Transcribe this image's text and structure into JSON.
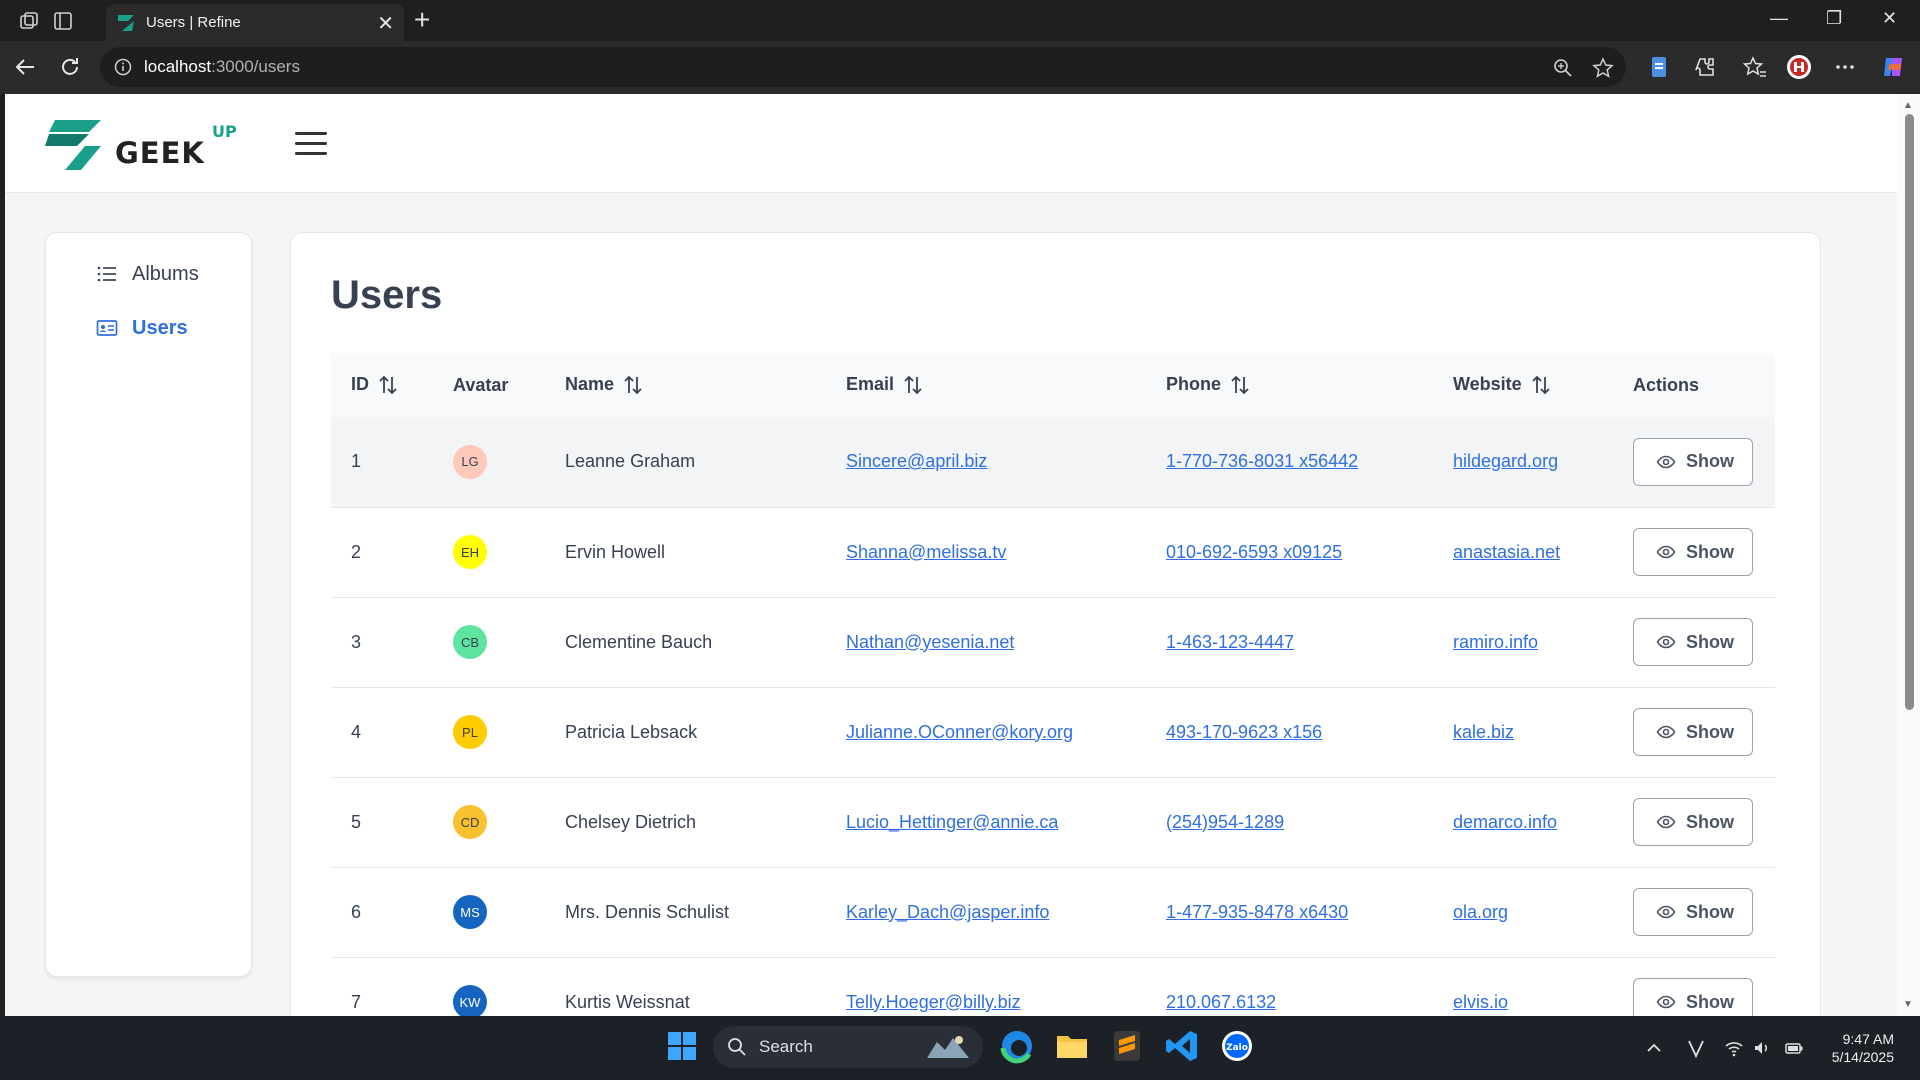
{
  "browser": {
    "tab_title": "Users | Refine",
    "tab_close": "✕",
    "new_tab": "+",
    "url_host": "localhost",
    "url_path": ":3000/users",
    "window_controls": [
      "—",
      "❐",
      "✕"
    ]
  },
  "app": {
    "logo_text": "GEEK",
    "logo_sup": "UP",
    "brand_color": "#1aa08a",
    "accent_color": "#2f6fe0"
  },
  "sidebar": {
    "items": [
      {
        "label": "Albums",
        "icon": "list-icon",
        "active": false
      },
      {
        "label": "Users",
        "icon": "id-card-icon",
        "active": true
      }
    ]
  },
  "page": {
    "title": "Users"
  },
  "table": {
    "columns": [
      "ID",
      "Avatar",
      "Name",
      "Email",
      "Phone",
      "Website",
      "Actions"
    ],
    "sortable": [
      true,
      false,
      true,
      true,
      true,
      true,
      false
    ],
    "action_label": "Show",
    "rows": [
      {
        "id": "1",
        "initials": "LG",
        "avatar_bg": "#ffc9b9",
        "name": "Leanne Graham",
        "email": "Sincere@april.biz",
        "phone": "1-770-736-8031 x56442",
        "website": "hildegard.org"
      },
      {
        "id": "2",
        "initials": "EH",
        "avatar_bg": "#ffff00",
        "name": "Ervin Howell",
        "email": "Shanna@melissa.tv",
        "phone": "010-692-6593 x09125",
        "website": "anastasia.net"
      },
      {
        "id": "3",
        "initials": "CB",
        "avatar_bg": "#5fe3a1",
        "name": "Clementine Bauch",
        "email": "Nathan@yesenia.net",
        "phone": "1-463-123-4447",
        "website": "ramiro.info"
      },
      {
        "id": "4",
        "initials": "PL",
        "avatar_bg": "#ffcc00",
        "name": "Patricia Lebsack",
        "email": "Julianne.OConner@kory.org",
        "phone": "493-170-9623 x156",
        "website": "kale.biz"
      },
      {
        "id": "5",
        "initials": "CD",
        "avatar_bg": "#fbc02d",
        "name": "Chelsey Dietrich",
        "email": "Lucio_Hettinger@annie.ca",
        "phone": "(254)954-1289",
        "website": "demarco.info"
      },
      {
        "id": "6",
        "initials": "MS",
        "avatar_bg": "#1565c0",
        "name": "Mrs. Dennis Schulist",
        "email": "Karley_Dach@jasper.info",
        "phone": "1-477-935-8478 x6430",
        "website": "ola.org"
      },
      {
        "id": "7",
        "initials": "KW",
        "avatar_bg": "#1565c0",
        "name": "Kurtis Weissnat",
        "email": "Telly.Hoeger@billy.biz",
        "phone": "210.067.6132",
        "website": "elvis.io"
      }
    ]
  },
  "taskbar": {
    "search_placeholder": "Search",
    "time": "9:47 AM",
    "date": "5/14/2025"
  }
}
